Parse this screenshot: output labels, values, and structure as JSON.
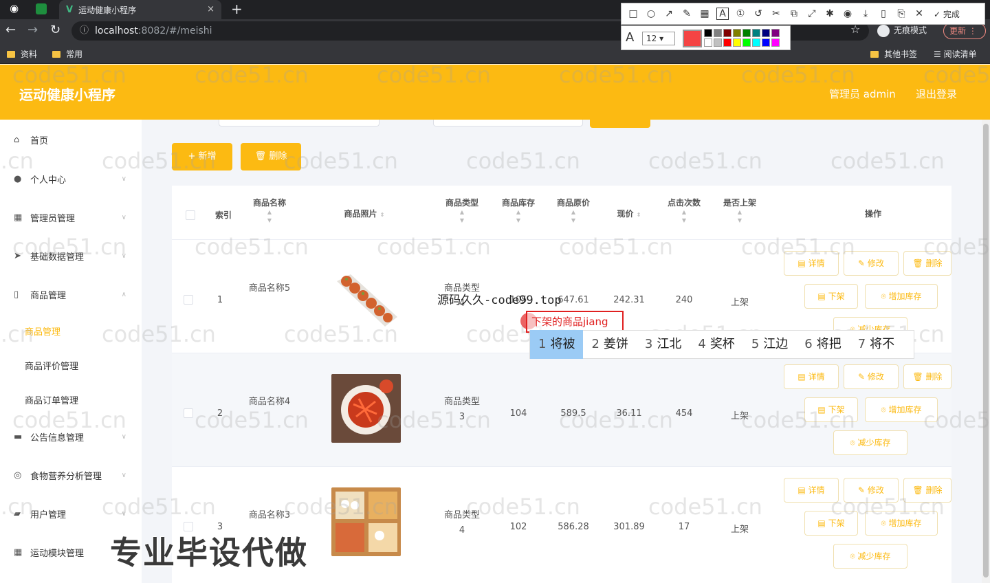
{
  "browser": {
    "tab_title": "运动健康小程序",
    "tab_close": "×",
    "new_tab": "+",
    "url_host": "localhost",
    "url_path": ":8082/#/meishi",
    "incognito": "无痕模式",
    "update_label": "更新",
    "bookmarks": [
      "资料",
      "常用"
    ],
    "bookmarks_right": [
      "其他书签",
      "阅读清单"
    ]
  },
  "annotation_toolbar": {
    "done_label": "完成",
    "font_size": "12",
    "icons": [
      "rect-icon",
      "ellipse-icon",
      "arrow-icon",
      "pen-icon",
      "mosaic-icon",
      "text-icon",
      "number-icon",
      "undo-icon",
      "cut-icon",
      "copy-icon",
      "expand-icon",
      "pin-icon",
      "record-icon",
      "download-icon",
      "phone-icon",
      "bookmark-icon",
      "close-icon"
    ],
    "colors": [
      "#000000",
      "#808080",
      "#800000",
      "#808000",
      "#008000",
      "#008080",
      "#000080",
      "#800080",
      "#ffffff",
      "#c0c0c0",
      "#ff0000",
      "#ffff00",
      "#00ff00",
      "#00ffff",
      "#0000ff",
      "#ff00ff"
    ],
    "current_color": "#f44444"
  },
  "header": {
    "title": "运动健康小程序",
    "admin": "管理员 admin",
    "logout": "退出登录"
  },
  "sidebar": {
    "items": [
      {
        "label": "首页",
        "icon": "home-icon"
      },
      {
        "label": "个人中心",
        "icon": "user-icon"
      },
      {
        "label": "管理员管理",
        "icon": "grid-icon"
      },
      {
        "label": "基础数据管理",
        "icon": "send-icon"
      },
      {
        "label": "商品管理",
        "icon": "phone-icon"
      },
      {
        "label": "公告信息管理",
        "icon": "briefcase-icon"
      },
      {
        "label": "食物营养分析管理",
        "icon": "compass-icon"
      },
      {
        "label": "用户管理",
        "icon": "people-icon"
      },
      {
        "label": "运动模块管理",
        "icon": "grid-icon"
      }
    ],
    "sub_items": [
      "商品管理",
      "商品评价管理",
      "商品订单管理"
    ]
  },
  "toolbar": {
    "add_label": "+ 新增",
    "delete_label": "删除"
  },
  "table": {
    "headers": [
      "索引",
      "商品名称",
      "商品照片",
      "商品类型",
      "商品库存",
      "商品原价",
      "现价",
      "点击次数",
      "是否上架",
      "操作"
    ],
    "rows": [
      {
        "index": "1",
        "name": "商品名称5",
        "type": "商品类型4",
        "stock": "105",
        "price": "647.61",
        "now": "242.31",
        "clicks": "240",
        "status": "上架"
      },
      {
        "index": "2",
        "name": "商品名称4",
        "type": "商品类型3",
        "stock": "104",
        "price": "589.5",
        "now": "36.11",
        "clicks": "454",
        "status": "上架"
      },
      {
        "index": "3",
        "name": "商品名称3",
        "type": "商品类型4",
        "stock": "102",
        "price": "586.28",
        "now": "301.89",
        "clicks": "17",
        "status": "上架"
      }
    ],
    "ops": [
      "详情",
      "修改",
      "删除",
      "下架",
      "增加库存",
      "减少库存"
    ]
  },
  "overlay": {
    "watermark": "code51.cn",
    "source_text": "源码久久-code99.top",
    "annotation_text": "下架的商品jiang",
    "ime_candidates": [
      {
        "num": "1",
        "word": "将被"
      },
      {
        "num": "2",
        "word": "姜饼"
      },
      {
        "num": "3",
        "word": "江北"
      },
      {
        "num": "4",
        "word": "奖杯"
      },
      {
        "num": "5",
        "word": "江边"
      },
      {
        "num": "6",
        "word": "将把"
      },
      {
        "num": "7",
        "word": "将不"
      }
    ],
    "big_text": "专业毕设代做"
  },
  "colors": {
    "accent": "#fcba12"
  }
}
